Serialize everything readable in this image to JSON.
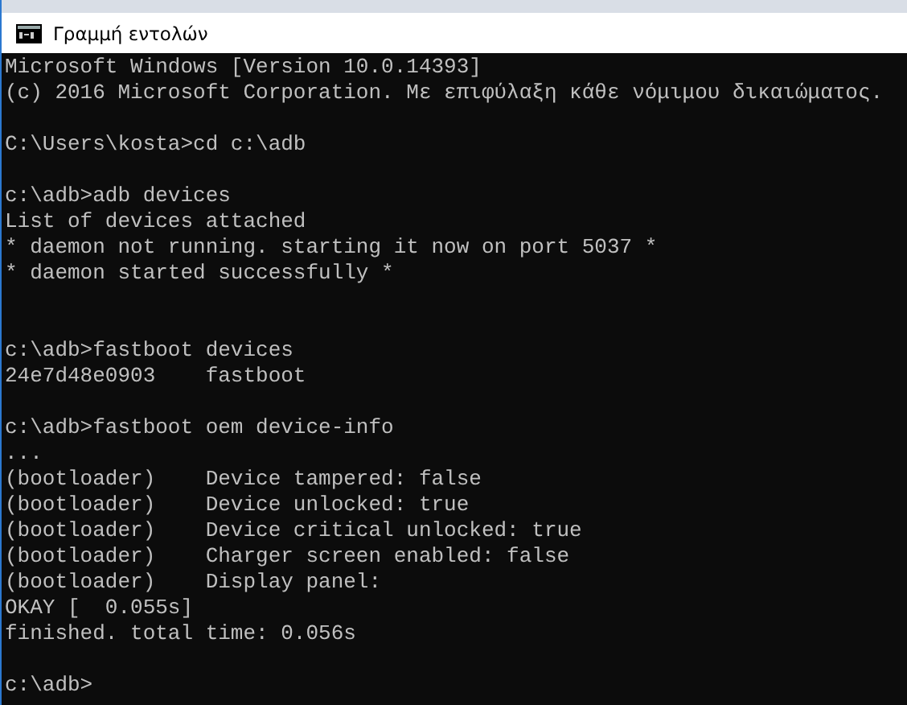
{
  "window": {
    "title": "Γραμμή εντολών"
  },
  "console": {
    "lines": [
      {
        "kind": "text",
        "text": "Microsoft Windows [Version 10.0.14393]"
      },
      {
        "kind": "text",
        "text": "(c) 2016 Microsoft Corporation. Με επιφύλαξη κάθε νόμιμου δικαιώματος."
      },
      {
        "kind": "blank"
      },
      {
        "kind": "text",
        "text": "C:\\Users\\kosta>cd c:\\adb"
      },
      {
        "kind": "blank"
      },
      {
        "kind": "text",
        "text": "c:\\adb>adb devices"
      },
      {
        "kind": "text",
        "text": "List of devices attached"
      },
      {
        "kind": "text",
        "text": "* daemon not running. starting it now on port 5037 *"
      },
      {
        "kind": "text",
        "text": "* daemon started successfully *"
      },
      {
        "kind": "blank"
      },
      {
        "kind": "blank"
      },
      {
        "kind": "text",
        "text": "c:\\adb>fastboot devices"
      },
      {
        "kind": "text",
        "text": "24e7d48e0903    fastboot"
      },
      {
        "kind": "blank"
      },
      {
        "kind": "text",
        "text": "c:\\adb>fastboot oem device-info"
      },
      {
        "kind": "text",
        "text": "..."
      },
      {
        "kind": "text",
        "text": "(bootloader)    Device tampered: false"
      },
      {
        "kind": "text",
        "text": "(bootloader)    Device unlocked: true"
      },
      {
        "kind": "text",
        "text": "(bootloader)    Device critical unlocked: true"
      },
      {
        "kind": "text",
        "text": "(bootloader)    Charger screen enabled: false"
      },
      {
        "kind": "text",
        "text": "(bootloader)    Display panel:"
      },
      {
        "kind": "text",
        "text": "OKAY [  0.055s]"
      },
      {
        "kind": "text",
        "text": "finished. total time: 0.056s"
      },
      {
        "kind": "blank"
      },
      {
        "kind": "text",
        "text": "c:\\adb>"
      }
    ]
  }
}
